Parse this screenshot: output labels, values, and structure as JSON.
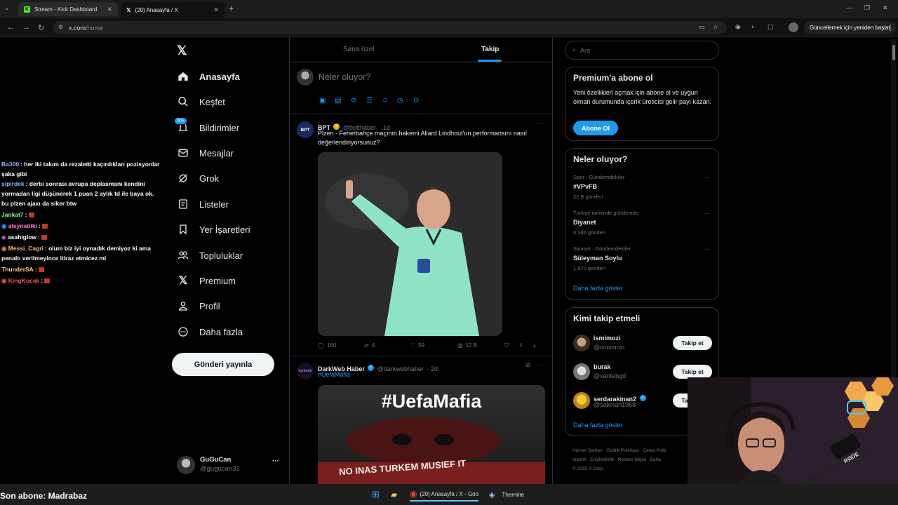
{
  "browser": {
    "tabs": [
      {
        "label": "Stream - Kick Dashboard",
        "close": "✕"
      },
      {
        "label": "(20) Anasayfa / X",
        "close": "✕"
      }
    ],
    "url_host": "x.com",
    "url_path": "/home",
    "update_label": "Güncellemek için yeniden başlat"
  },
  "chat": [
    {
      "user": "Ba300",
      "user_color": "#8fb3ff",
      "text": ": her iki takım da rezaletti kaçırdıkları pozisyonlar şaka gibi"
    },
    {
      "user": "sipirdek",
      "user_color": "#8fb3ff",
      "text": ": derbi sonrası avrupa deplasmanı kendini yormadan ligi düşünerek 1 puan 2 aylık td ile baya ok. bu plzen ajaxı da siker btw"
    },
    {
      "user": "Jankat7",
      "user_color": "#7fff7f",
      "text": ":"
    },
    {
      "user": "aleynatilki",
      "user_color": "#ff79c6",
      "text": ":"
    },
    {
      "user": "asahiglow",
      "user_color": "#ffffff",
      "text": ":"
    },
    {
      "user": "Messi_Cagri",
      "user_color": "#ffb86c",
      "text": ": olum biz iyi oynadık demiyoz ki ama penaltı verilmeyince itiraz etmicez mi"
    },
    {
      "user": "ThunderSA",
      "user_color": "#ffd27f",
      "text": ":"
    },
    {
      "user": "KingKocak",
      "user_color": "#ff5555",
      "text": ":"
    }
  ],
  "sidebar": {
    "items": [
      {
        "label": "Anasayfa",
        "icon": "home-icon"
      },
      {
        "label": "Keşfet",
        "icon": "search-icon"
      },
      {
        "label": "Bildirimler",
        "icon": "bell-icon",
        "badge": "20+"
      },
      {
        "label": "Mesajlar",
        "icon": "mail-icon"
      },
      {
        "label": "Grok",
        "icon": "grok-icon"
      },
      {
        "label": "Listeler",
        "icon": "list-icon"
      },
      {
        "label": "Yer İşaretleri",
        "icon": "bookmark-icon"
      },
      {
        "label": "Topluluklar",
        "icon": "people-icon"
      },
      {
        "label": "Premium",
        "icon": "x-logo-icon"
      },
      {
        "label": "Profil",
        "icon": "user-icon"
      },
      {
        "label": "Daha fazla",
        "icon": "more-circle-icon"
      }
    ],
    "post_button": "Gönderi yayınla",
    "account": {
      "name": "GuGuCan",
      "handle": "@gugucan31"
    }
  },
  "feed": {
    "tabs": [
      "Sana özel",
      "Takip"
    ],
    "composer_placeholder": "Neler oluyor?",
    "composer_post": "Gönderi yayınla",
    "tweets": [
      {
        "avatar_text": "BPT",
        "name": "BPT",
        "handle": "@bptthaber",
        "time": "· 1d",
        "text": "Plzen - Fenerbahçe maçının hakemi Allard Lindhout'un performansını nasıl değerlendiriyorsunuz?",
        "replies": "160",
        "retweets": "4",
        "likes": "59",
        "views": "12 B"
      },
      {
        "avatar_text": "darkweb",
        "name": "DarkWeb Haber",
        "handle": "@darkwebhaber",
        "time": "· 2d",
        "hashtag": "#UefaMafia",
        "image_text": "#UefaMafia",
        "banner_text": "NO INAS TURKEM MUSIEF IT"
      }
    ]
  },
  "right": {
    "search_placeholder": "Ara",
    "premium": {
      "title": "Premium'a abone ol",
      "text": "Yeni özellikleri açmak için abone ol ve uygun olman durumunda içerik üreticisi gelir payı kazan.",
      "button": "Abone Ol"
    },
    "trends": {
      "title": "Neler oluyor?",
      "items": [
        {
          "context": "Spor · Gündemdekiler",
          "name": "#VPvFB",
          "count": "22 B gönderi"
        },
        {
          "context": "Türkiye tarihinde gündemde",
          "name": "Diyanet",
          "count": "8.366 gönderi"
        },
        {
          "context": "Siyaset · Gündemdekiler",
          "name": "Süleyman Soylu",
          "count": "1.870 gönderi"
        }
      ],
      "more": "Daha fazla göster"
    },
    "follow": {
      "title": "Kimi takip etmeli",
      "items": [
        {
          "name": "ismimozi",
          "handle": "@ismimozi",
          "button": "Takip et"
        },
        {
          "name": "burak",
          "handle": "@xantebgd",
          "button": "Takip et"
        },
        {
          "name": "serdarakinan2",
          "handle": "@sakinan1968",
          "button": "Takip et"
        }
      ],
      "more": "Daha fazla göster"
    },
    "footer": [
      "Hizmet Şartları",
      "Gizlilik Politikası",
      "Çerez Politi",
      "Imprint",
      "Erişilebilirlik",
      "Reklam bilgisi",
      "Daha",
      "© 2025 X Corp."
    ]
  },
  "stream_overlay": {
    "last_sub": "Son abone: Madrabaz"
  },
  "taskbar": {
    "chrome_label": "(20) Anasayfa / X - Goo",
    "thermite_label": "Thermite"
  },
  "colors": {
    "accent": "#1d9bf0",
    "bg": "#000000",
    "border": "#2f3336"
  }
}
